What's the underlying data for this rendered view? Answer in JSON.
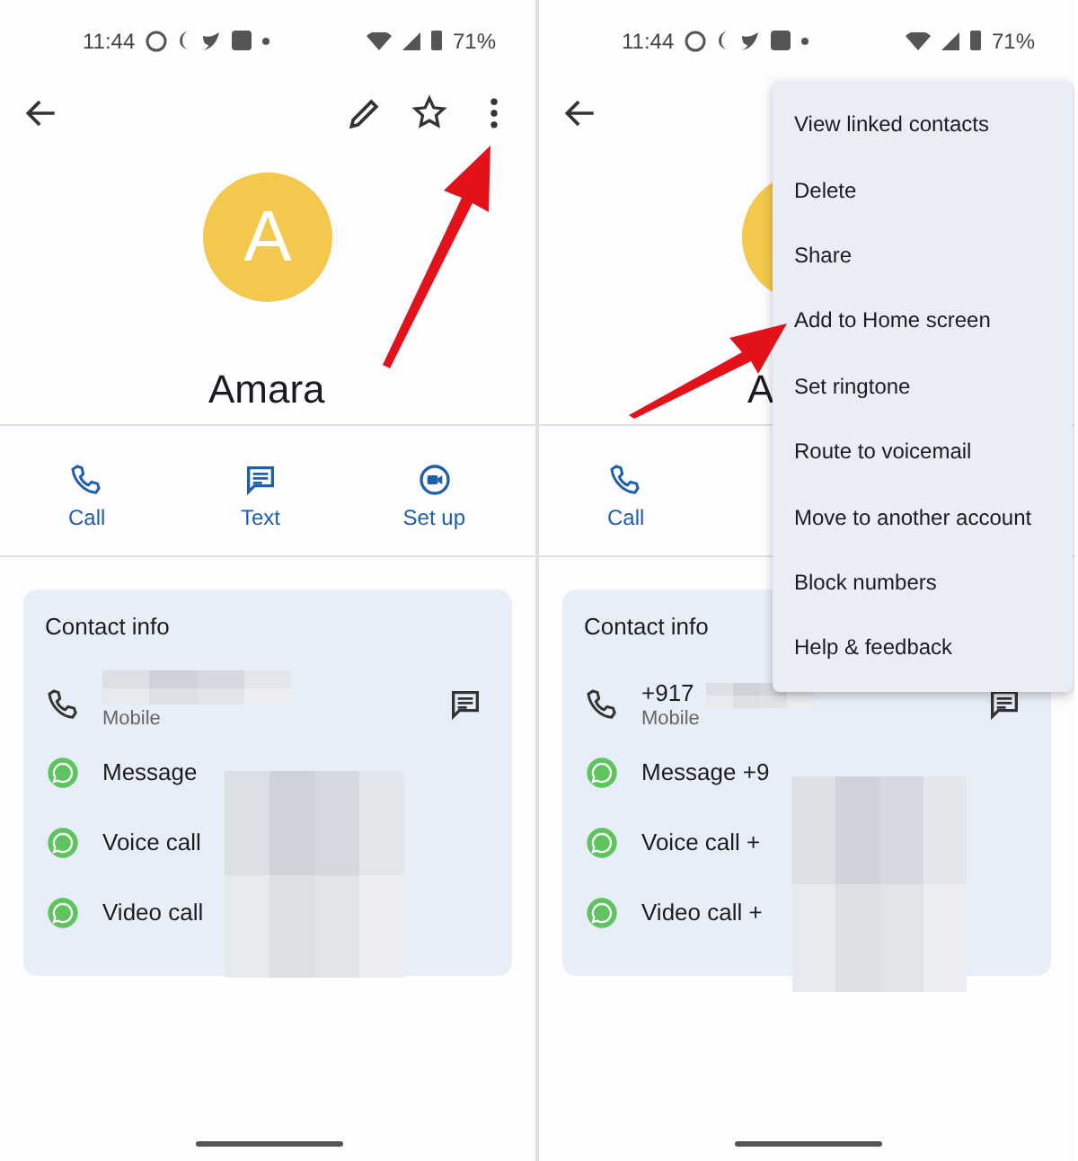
{
  "screens": [
    {
      "status_bar": {
        "time": "11:44",
        "battery": "71%"
      },
      "toolbar": [
        {
          "kind": "back"
        },
        {
          "kind": "edit"
        },
        {
          "kind": "star"
        },
        {
          "kind": "more"
        }
      ],
      "avatar": {
        "letter": "A"
      },
      "name": "Amara",
      "pointer_arrow": true,
      "actions": [
        {
          "kind": "call",
          "label": "Call"
        },
        {
          "kind": "text",
          "label": "Text"
        },
        {
          "kind": "video",
          "label": "Set up"
        }
      ],
      "contact_info": {
        "title": "Contact info",
        "phone": {
          "type": "Mobile"
        },
        "whatsapp": [
          "Message",
          "Voice call",
          "Video call"
        ]
      }
    },
    {
      "status_bar": {
        "time": "11:44",
        "battery": "71%"
      },
      "toolbar": [
        {
          "kind": "back"
        }
      ],
      "name": "A",
      "pointer_arrow": true,
      "actions": [
        {
          "kind": "call",
          "label": "Call"
        }
      ],
      "contact_info": {
        "title": "Contact info",
        "phone": {
          "number": "+917",
          "type": "Mobile"
        },
        "whatsapp": [
          "Message +9",
          "Voice call +",
          "Video call +"
        ]
      },
      "menu": [
        "View linked contacts",
        "Delete",
        "Share",
        "Add to Home screen",
        "Set ringtone",
        "Route to voicemail",
        "Move to another account",
        "Block numbers",
        "Help & feedback"
      ]
    }
  ]
}
